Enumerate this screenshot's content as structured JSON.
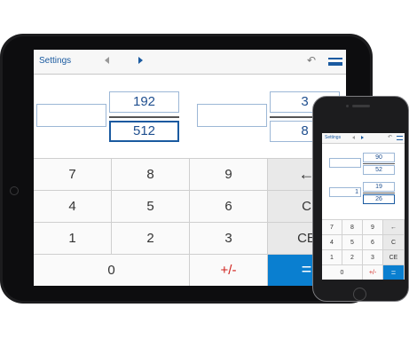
{
  "tablet": {
    "nav": {
      "settings": "Settings",
      "undo_icon": "↶"
    },
    "fraction1": {
      "whole": "",
      "numerator": "192",
      "denominator": "512"
    },
    "fraction2": {
      "whole": "",
      "numerator": "3",
      "denominator": "8"
    },
    "keys": {
      "k7": "7",
      "k8": "8",
      "k9": "9",
      "backspace": "←",
      "k4": "4",
      "k5": "5",
      "k6": "6",
      "clear": "C",
      "k1": "1",
      "k2": "2",
      "k3": "3",
      "clear_entry": "CE",
      "k0": "0",
      "sign": "+/-",
      "equals": "="
    }
  },
  "phone": {
    "nav": {
      "settings": "Settings",
      "undo_icon": "↶"
    },
    "fraction1": {
      "whole": "",
      "numerator": "90",
      "denominator": "52"
    },
    "fraction2": {
      "whole": "1",
      "numerator": "19",
      "denominator": "26"
    },
    "keys": {
      "k7": "7",
      "k8": "8",
      "k9": "9",
      "backspace": "←",
      "k4": "4",
      "k5": "5",
      "k6": "6",
      "clear": "C",
      "k1": "1",
      "k2": "2",
      "k3": "3",
      "clear_entry": "CE",
      "k0": "0",
      "sign": "+/-",
      "equals": "="
    }
  },
  "colors": {
    "accent": "#1a5aa0",
    "equals_bg": "#0a7fd0",
    "sign_text": "#d0201b"
  }
}
